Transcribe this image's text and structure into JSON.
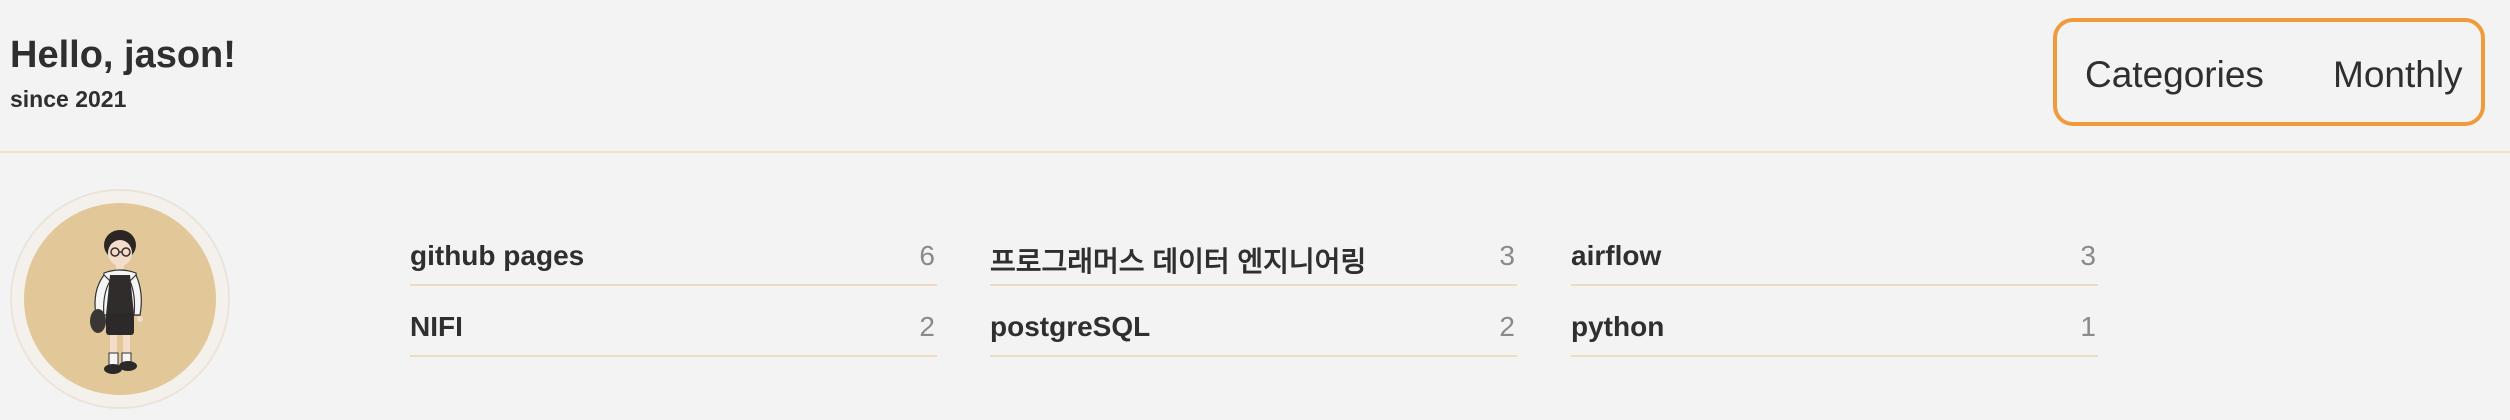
{
  "header": {
    "greeting": "Hello, jason!",
    "since": "since 2021"
  },
  "nav": {
    "categories_label": "Categories",
    "monthly_label": "Monthly"
  },
  "colors": {
    "accent_border": "#ef9b3b",
    "avatar_bg": "#e2c899",
    "divider": "#eddcbf",
    "background": "#f3f3f3"
  },
  "categories": [
    {
      "name": "github pages",
      "count": "6"
    },
    {
      "name": "프로그래머스 데이터 엔지니어링",
      "count": "3"
    },
    {
      "name": "airflow",
      "count": "3"
    },
    {
      "name": "NIFI",
      "count": "2"
    },
    {
      "name": "postgreSQL",
      "count": "2"
    },
    {
      "name": "python",
      "count": "1"
    }
  ]
}
